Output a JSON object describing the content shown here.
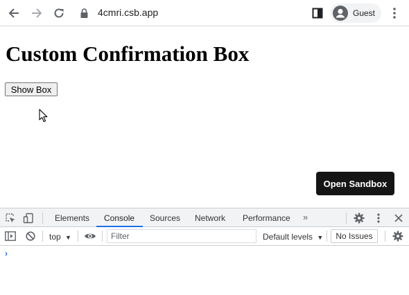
{
  "browser": {
    "url": "4cmri.csb.app",
    "profile_label": "Guest",
    "icons": [
      "back-arrow-icon",
      "forward-arrow-icon",
      "reload-icon",
      "lock-icon",
      "side-panel-icon",
      "avatar-icon",
      "kebab-menu-icon"
    ]
  },
  "page": {
    "title": "Custom Confirmation Box",
    "show_box_button": "Show Box",
    "open_sandbox_button": "Open Sandbox"
  },
  "devtools": {
    "tabs": [
      {
        "label": "Elements",
        "active": false
      },
      {
        "label": "Console",
        "active": true
      },
      {
        "label": "Sources",
        "active": false
      },
      {
        "label": "Network",
        "active": false
      },
      {
        "label": "Performance",
        "active": false
      }
    ],
    "more_tabs": "»",
    "console": {
      "context": "top",
      "filter_placeholder": "Filter",
      "levels": "Default levels",
      "issues": "No Issues",
      "prompt": "›"
    }
  },
  "colors": {
    "accent": "#1a73e8",
    "sandbox_button_bg": "#151515"
  }
}
